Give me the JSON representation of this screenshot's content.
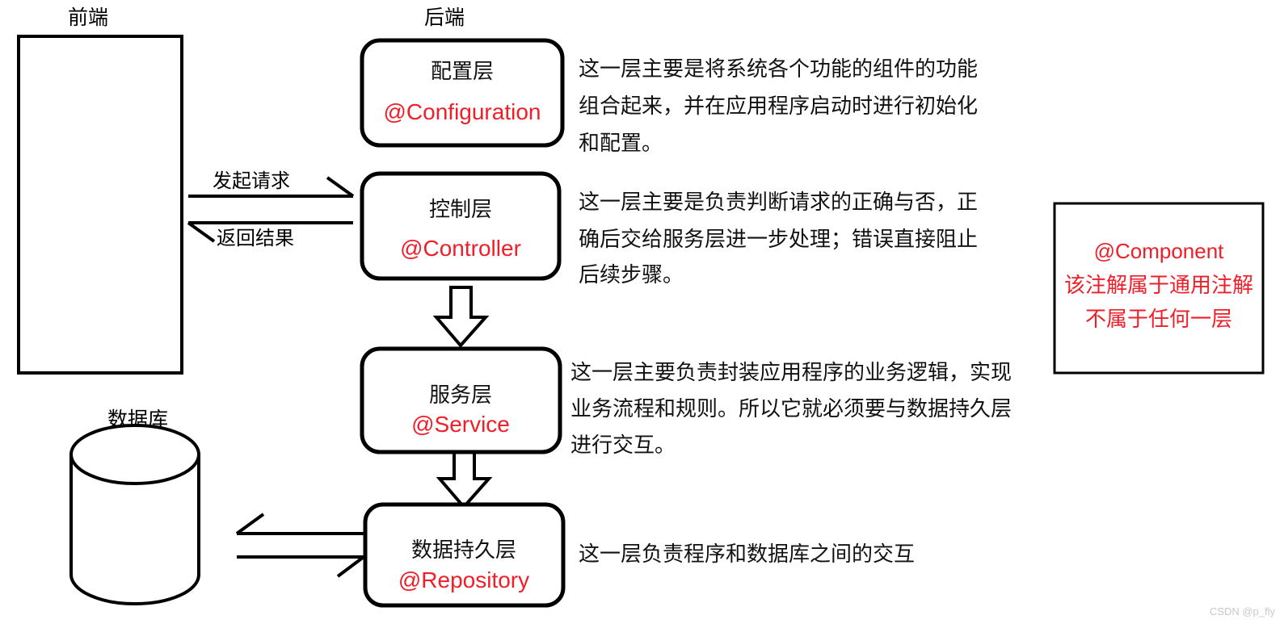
{
  "headers": {
    "frontend": "前端",
    "backend": "后端"
  },
  "frontend_panel": {
    "name": "frontend-box",
    "content": ""
  },
  "database": {
    "label": "数据库"
  },
  "flow_arrows": {
    "request_label": "发起请求",
    "response_label": "返回结果"
  },
  "layers": [
    {
      "id": "configuration",
      "title": "配置层",
      "annotation": "@Configuration",
      "description": [
        "这一层主要是将系统各个功能的组件的功能",
        "组合起来，并在应用程序启动时进行初始化",
        "和配置。"
      ]
    },
    {
      "id": "controller",
      "title": "控制层",
      "annotation": "@Controller",
      "description": [
        "这一层主要是负责判断请求的正确与否，正",
        "确后交给服务层进一步处理；错误直接阻止",
        "后续步骤。"
      ]
    },
    {
      "id": "service",
      "title": "服务层",
      "annotation": "@Service",
      "description": [
        "这一层主要负责封装应用程序的业务逻辑，实现",
        "业务流程和规则。所以它就必须要与数据持久层",
        "进行交互。"
      ]
    },
    {
      "id": "repository",
      "title": "数据持久层",
      "annotation": "@Repository",
      "description": [
        "这一层负责程序和数据库之间的交互"
      ]
    }
  ],
  "component_note": {
    "annotation": "@Component",
    "lines": [
      "该注解属于通用注解",
      "不属于任何一层"
    ]
  },
  "watermark": {
    "text": "CSDN @p_fly"
  },
  "colors": {
    "annotation_red": "#f01e28",
    "stroke_black": "#000000",
    "background": "#ffffff",
    "watermark_gray": "#c8c8c8"
  }
}
